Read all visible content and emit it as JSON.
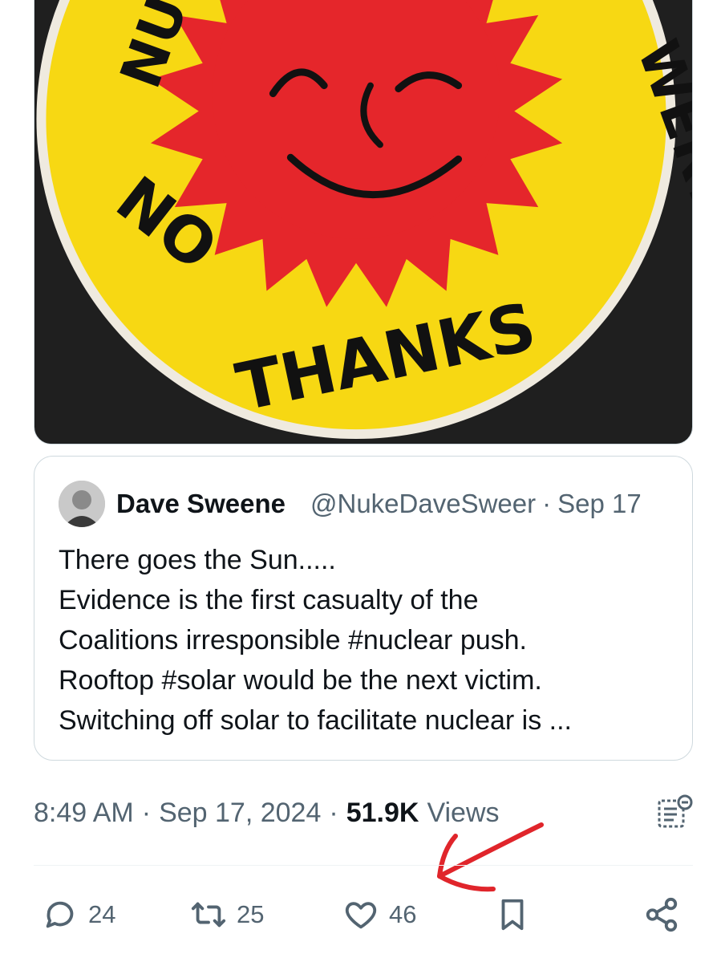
{
  "media": {
    "sticker_top_left": "NU",
    "sticker_top_right": "WER?",
    "sticker_no": "NO",
    "sticker_thanks": "THANKS",
    "colors": {
      "yellow": "#f7d813",
      "red": "#e5262b",
      "background": "#1f1f1f"
    }
  },
  "quote": {
    "name": "Dave Sweene",
    "handle": "@NukeDaveSweer",
    "separator": "·",
    "date": "Sep 17",
    "lines": [
      "There goes the Sun.....",
      "Evidence is the first casualty of the",
      "Coalitions irresponsible #nuclear push.",
      "Rooftop #solar would be the next victim.",
      "Switching off solar to facilitate nuclear is ..."
    ]
  },
  "meta": {
    "time": "8:49 AM",
    "sep1": "·",
    "date": "Sep 17, 2024",
    "sep2": "·",
    "views_count": "51.9K",
    "views_label": "Views"
  },
  "actions": {
    "reply_count": "24",
    "retweet_count": "25",
    "like_count": "46"
  },
  "icons": [
    "reply-icon",
    "retweet-icon",
    "like-icon",
    "bookmark-icon",
    "share-icon",
    "post-analytics-icon"
  ],
  "annotation": {
    "arrow_color": "#e0252b"
  }
}
